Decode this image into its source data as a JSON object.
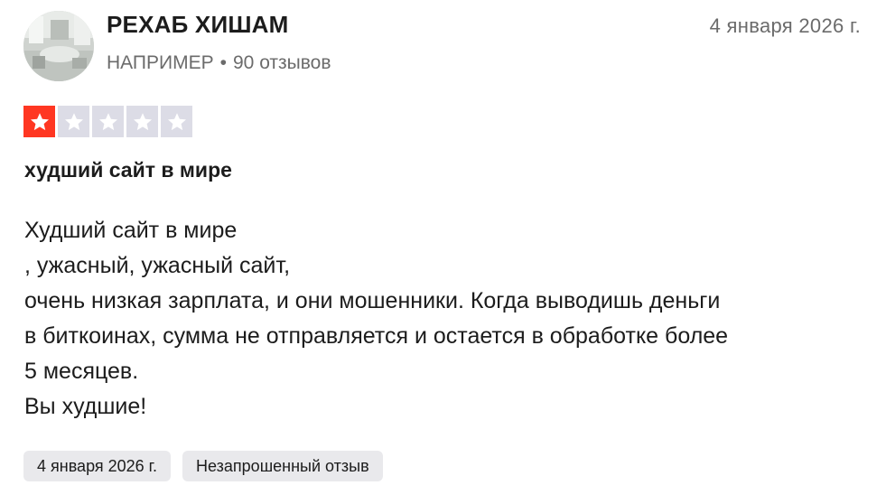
{
  "reviewer": {
    "name": "РЕХАБ ХИШАМ",
    "country": "НАПРИМЕР",
    "separator": "•",
    "reviews_count": "90 отзывов",
    "avatar_icon": "user-photo-avatar"
  },
  "review": {
    "date": "4 января 2026 г.",
    "rating": 1,
    "rating_max": 5,
    "star_colors": {
      "filled": "#ff3722",
      "empty": "#dcdce6"
    },
    "title": "худший сайт в мире",
    "body_lines": [
      "Худший сайт в мире",
      ", ужасный, ужасный сайт,",
      "очень низкая зарплата, и они мошенники. Когда выводишь деньги",
      "в биткоинах, сумма не отправляется и остается в обработке более",
      "5 месяцев.",
      "Вы худшие!"
    ]
  },
  "tags": [
    "4 января 2026 г.",
    "Незапрошенный отзыв"
  ]
}
